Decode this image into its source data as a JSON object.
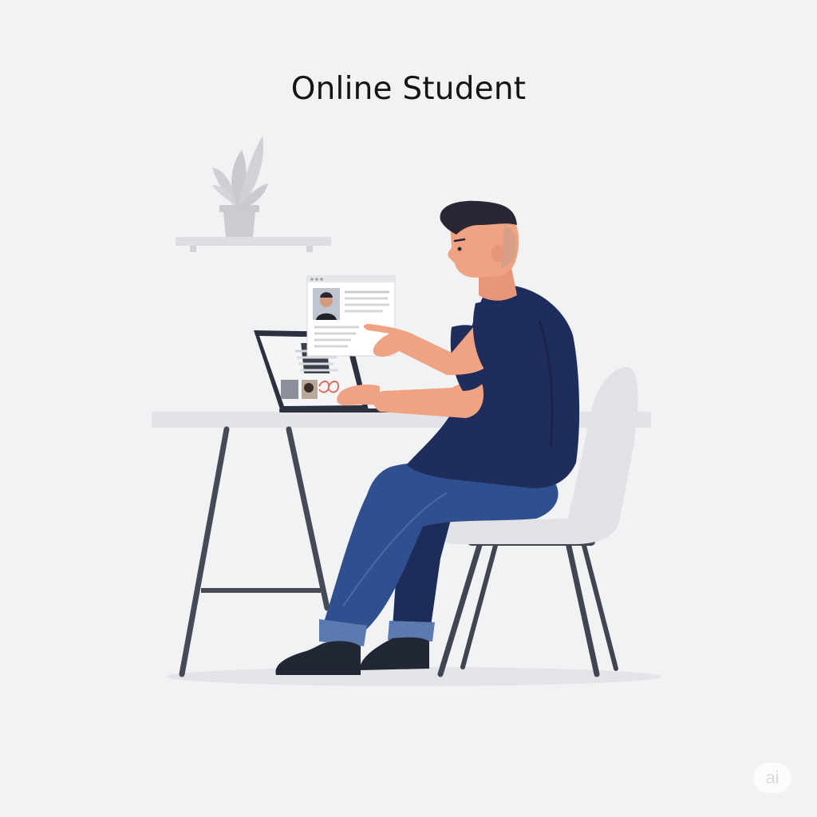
{
  "title": "Online Student",
  "watermark": "ai",
  "colors": {
    "background": "#f1f2f4",
    "shirt": "#1e2d5c",
    "jeans": "#2f4f8f",
    "skin": "#f0a382",
    "hair": "#2a2633",
    "desk_top": "#e3e4e7",
    "chair": "#e1e2e5",
    "metal_legs": "#444a56",
    "plant": "#c9cacd"
  },
  "icons": {
    "plant": "potted-plant-icon",
    "shelf": "wall-shelf-icon",
    "laptop": "laptop-icon",
    "profile_card": "profile-card-icon"
  }
}
